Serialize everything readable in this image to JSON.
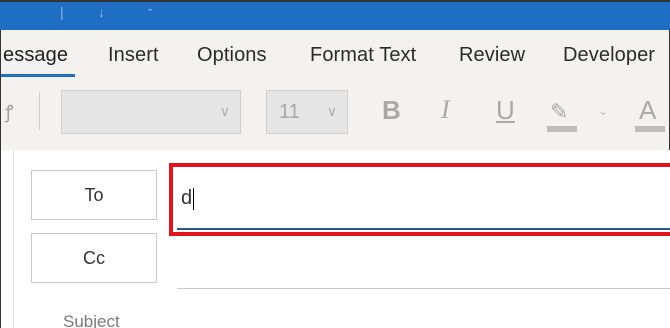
{
  "window": {
    "quick_access_icons": [
      "undo-icon",
      "arrow-down-icon",
      "customize-icon"
    ]
  },
  "ribbon": {
    "tabs": [
      {
        "label": "essage"
      },
      {
        "label": "Insert"
      },
      {
        "label": "Options"
      },
      {
        "label": "Format Text"
      },
      {
        "label": "Review"
      },
      {
        "label": "Developer"
      }
    ],
    "font_name": "",
    "font_size": "11",
    "bold_label": "B",
    "italic_label": "I",
    "underline_label": "U",
    "font_color_label": "A"
  },
  "compose": {
    "to_button": "To",
    "cc_button": "Cc",
    "to_value": "d",
    "subject_label": "Subject"
  }
}
